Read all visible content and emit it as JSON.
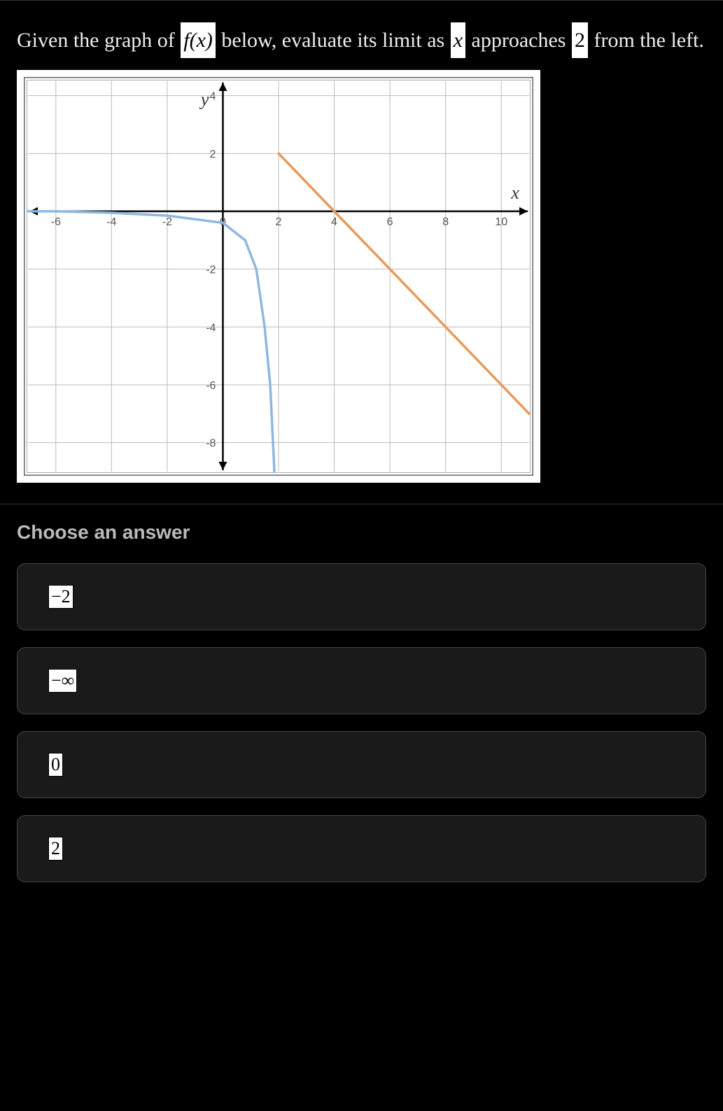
{
  "question": {
    "part1": "Given the graph of ",
    "fx": "f(x)",
    "part2": " below, evaluate its limit as ",
    "x": "x",
    "part3": " approaches ",
    "val": "2",
    "part4": " from the left."
  },
  "chart_data": {
    "type": "line",
    "xlabel": "x",
    "ylabel": "y",
    "xlim": [
      -7,
      11
    ],
    "ylim": [
      -9,
      4.5
    ],
    "xticks": [
      -6,
      -4,
      -2,
      0,
      2,
      4,
      6,
      8,
      10
    ],
    "yticks": [
      -8,
      -6,
      -4,
      -2,
      0,
      2,
      4
    ],
    "series": [
      {
        "name": "blue-curve",
        "color": "#8fb7e0",
        "points": [
          [
            -7,
            0
          ],
          [
            -6,
            0
          ],
          [
            -4,
            -0.05
          ],
          [
            -2,
            -0.15
          ],
          [
            0,
            -0.4
          ],
          [
            0.8,
            -1
          ],
          [
            1.2,
            -2
          ],
          [
            1.5,
            -4
          ],
          [
            1.7,
            -6
          ],
          [
            1.8,
            -8
          ],
          [
            1.85,
            -9
          ]
        ]
      },
      {
        "name": "orange-line",
        "color": "#e89a5a",
        "points": [
          [
            2,
            2
          ],
          [
            11,
            -7
          ]
        ]
      }
    ]
  },
  "answer": {
    "header": "Choose an answer",
    "options": [
      "−2",
      "−∞",
      "0",
      "2"
    ]
  }
}
